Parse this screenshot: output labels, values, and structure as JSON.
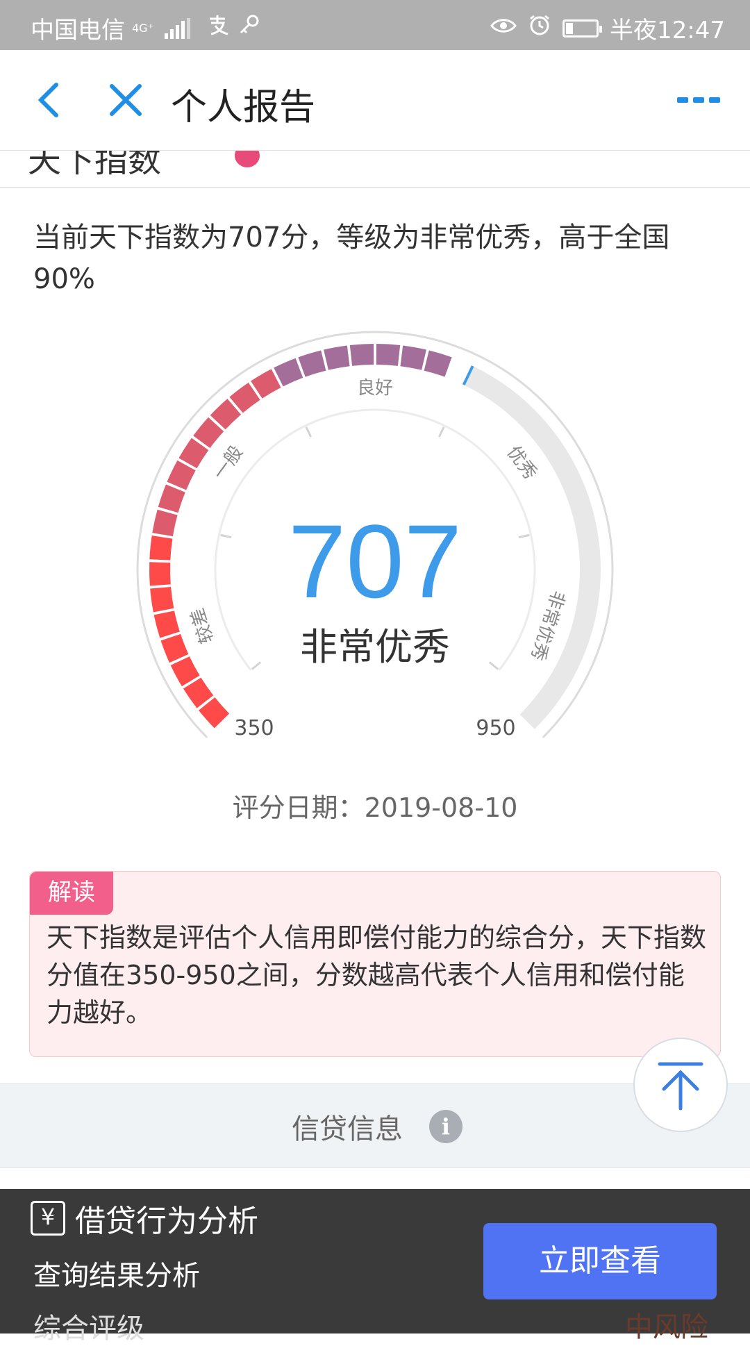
{
  "status_bar": {
    "carrier": "中国电信",
    "network": "4G⁺",
    "time": "半夜12:47"
  },
  "nav": {
    "title": "个人报告"
  },
  "peek_title": "天下指数",
  "summary": "当前天下指数为707分，等级为非常优秀，高于全国90%",
  "gauge": {
    "score": 707,
    "score_text": "707",
    "level": "非常优秀",
    "min": 350,
    "max": 950,
    "min_label": "350",
    "max_label": "950",
    "zones": [
      "较差",
      "一般",
      "良好",
      "优秀",
      "非常优秀"
    ],
    "colors": {
      "poor": "#ff4a4a",
      "fair": "#dc5c6e",
      "good": "#a46e9a",
      "excellent": "#6c8cd8",
      "empty": "#e8e8e8",
      "score": "#3d9be9"
    }
  },
  "date_line": "评分日期：2019-08-10",
  "explain": {
    "badge": "解读",
    "text": "天下指数是评估个人信用即偿付能力的综合分，天下指数分值在350-950之间，分数越高代表个人信用和偿付能力越好。"
  },
  "credit_section": {
    "label": "信贷信息",
    "info_icon": "i"
  },
  "bottom_overlay": {
    "item1": "借贷行为分析",
    "item2": "查询结果分析",
    "item3": "综合评级",
    "ghost_text": "中风险",
    "cta": "立即查看"
  }
}
